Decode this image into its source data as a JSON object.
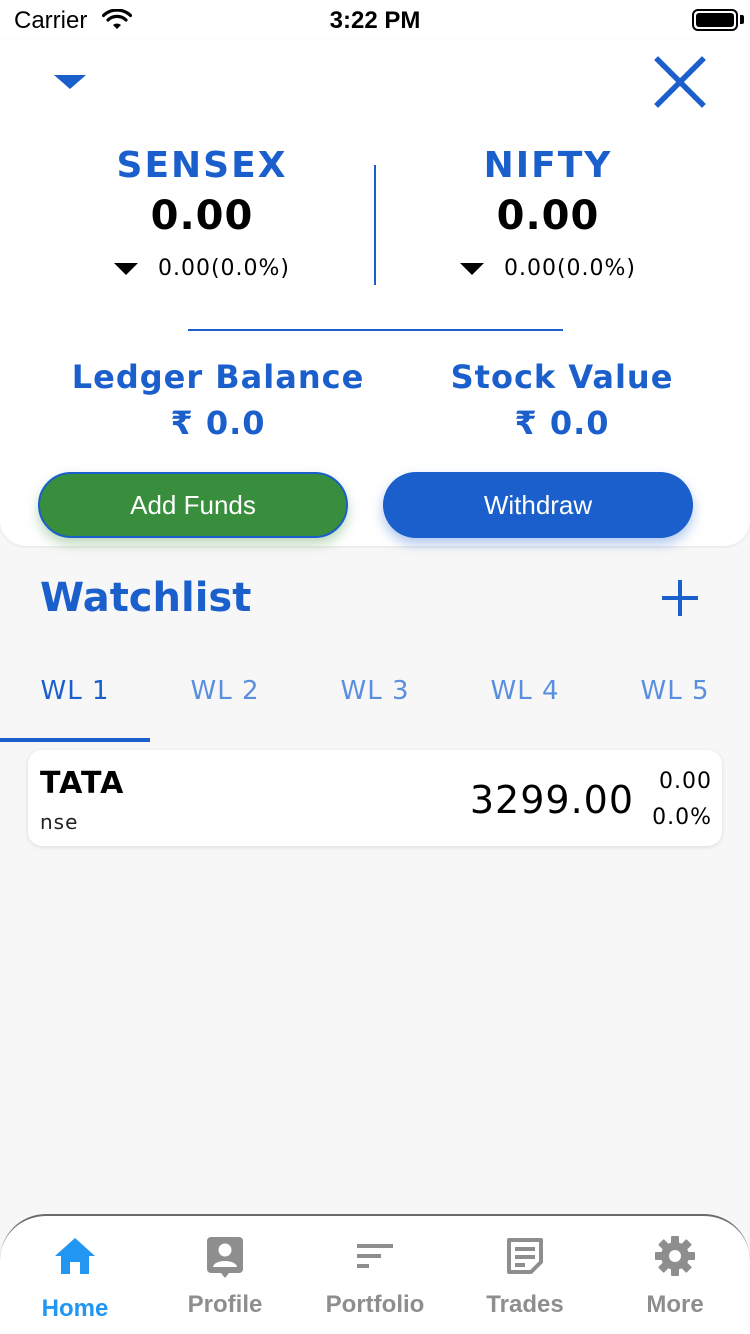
{
  "status_bar": {
    "carrier": "Carrier",
    "time": "3:22 PM"
  },
  "indices": [
    {
      "name": "SENSEX",
      "value": "0.00",
      "change": "0.00(0.0%)"
    },
    {
      "name": "NIFTY",
      "value": "0.00",
      "change": "0.00(0.0%)"
    }
  ],
  "balances": {
    "ledger": {
      "label": "Ledger Balance",
      "value": "₹ 0.0"
    },
    "stock": {
      "label": "Stock Value",
      "value": "₹ 0.0"
    }
  },
  "actions": {
    "add_funds": "Add Funds",
    "withdraw": "Withdraw"
  },
  "watchlist": {
    "title": "Watchlist",
    "tabs": [
      "WL 1",
      "WL 2",
      "WL 3",
      "WL 4",
      "WL 5"
    ],
    "active_tab": "WL 1",
    "items": [
      {
        "symbol": "TATA",
        "exchange": "nse",
        "price": "3299.00",
        "change": "0.00",
        "change_pct": "0.0%"
      }
    ]
  },
  "bottom_nav": {
    "items": [
      {
        "label": "Home",
        "icon": "home-icon",
        "active": true
      },
      {
        "label": "Profile",
        "icon": "profile-icon",
        "active": false
      },
      {
        "label": "Portfolio",
        "icon": "portfolio-icon",
        "active": false
      },
      {
        "label": "Trades",
        "icon": "trades-icon",
        "active": false
      },
      {
        "label": "More",
        "icon": "gear-icon",
        "active": false
      }
    ]
  },
  "colors": {
    "primary": "#1a5fcc",
    "success": "#388e3c",
    "nav_active": "#2196f3",
    "nav_inactive": "#8e8e8e"
  }
}
